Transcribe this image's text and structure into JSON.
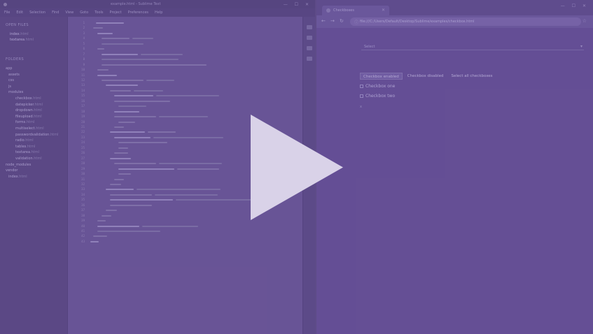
{
  "editor": {
    "title": "example.html - Sublime Text",
    "menu": [
      "File",
      "Edit",
      "Selection",
      "Find",
      "View",
      "Goto",
      "Tools",
      "Project",
      "Preferences",
      "Help"
    ],
    "sidebar": {
      "open_files_header": "OPEN FILES",
      "open_files": [
        {
          "name": "index",
          "ext": ".html"
        },
        {
          "name": "textarea",
          "ext": ".html"
        }
      ],
      "folders_header": "FOLDERS",
      "tree": [
        {
          "name": "app",
          "ext": ""
        },
        {
          "name": "assets",
          "ext": ""
        },
        {
          "name": "css",
          "ext": ""
        },
        {
          "name": "js",
          "ext": ""
        },
        {
          "name": "modules",
          "ext": ""
        },
        {
          "name": "checkbox",
          "ext": ".html"
        },
        {
          "name": "datepicker",
          "ext": ".html"
        },
        {
          "name": "dropdown",
          "ext": ".html"
        },
        {
          "name": "fileupload",
          "ext": ".html"
        },
        {
          "name": "forms",
          "ext": ".html"
        },
        {
          "name": "multiselect",
          "ext": ".html"
        },
        {
          "name": "passwordvalidation",
          "ext": ".html"
        },
        {
          "name": "radio",
          "ext": ".html"
        },
        {
          "name": "tables",
          "ext": ".html"
        },
        {
          "name": "textarea",
          "ext": ".html"
        },
        {
          "name": "validation",
          "ext": ".html"
        },
        {
          "name": "node_modules",
          "ext": ""
        },
        {
          "name": "vendor",
          "ext": ""
        },
        {
          "name": "index",
          "ext": ".html"
        }
      ]
    }
  },
  "browser": {
    "tab_label": "Checkboxes",
    "url": "file:///C:/Users/Default/Desktop/Sublime/examples/checkbox.html",
    "page": {
      "select_label": "Select",
      "buttons": [
        "Checkbox enabled",
        "Checkbox disabled",
        "Select all checkboxes"
      ],
      "checkboxes": [
        "Checkbox one",
        "Checkbox two"
      ],
      "footnote": "x"
    }
  },
  "video": {
    "play_label": "Play video"
  }
}
